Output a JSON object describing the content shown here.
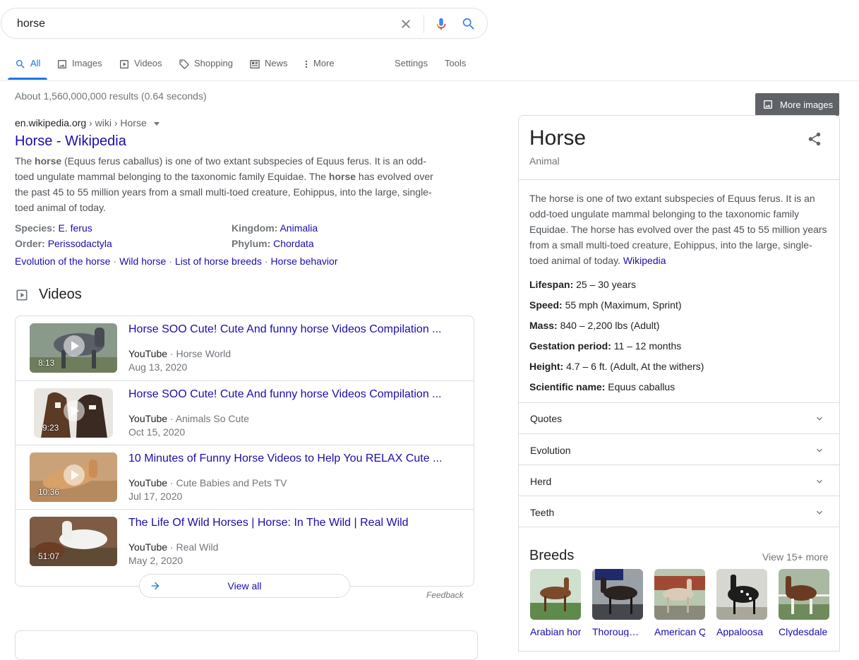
{
  "search": {
    "query": "horse"
  },
  "tabs": [
    {
      "label": "All",
      "icon": "search-icon"
    },
    {
      "label": "Images",
      "icon": "image-icon"
    },
    {
      "label": "Videos",
      "icon": "play-icon"
    },
    {
      "label": "Shopping",
      "icon": "tag-icon"
    },
    {
      "label": "News",
      "icon": "news-icon"
    },
    {
      "label": "More",
      "icon": "more-vert-icon"
    },
    {
      "label": "Settings"
    },
    {
      "label": "Tools"
    }
  ],
  "stats": "About 1,560,000,000 results (0.64 seconds)",
  "result": {
    "domain": "en.wikipedia.org",
    "path": " › wiki › Horse",
    "title": "Horse - Wikipedia",
    "snippet": [
      {
        "t": "The ",
        "b": false
      },
      {
        "t": "horse",
        "b": true
      },
      {
        "t": " (Equus ferus caballus) is one of two extant subspecies of Equus ferus. It is an odd-toed ungulate mammal belonging to the taxonomic family Equidae. The ",
        "b": false
      },
      {
        "t": "horse",
        "b": true
      },
      {
        "t": " has evolved over the past 45 to 55 million years from a small multi-toed creature, Eohippus, into the large, single-toed animal of today.",
        "b": false
      }
    ],
    "facts": [
      {
        "k": "Species:",
        "v": "E. ferus"
      },
      {
        "k": "Kingdom:",
        "v": "Animalia"
      },
      {
        "k": "Order:",
        "v": "Perissodactyla"
      },
      {
        "k": "Phylum:",
        "v": "Chordata"
      }
    ],
    "sitelinks": [
      "Evolution of the horse",
      "Wild horse",
      "List of horse breeds",
      "Horse behavior"
    ]
  },
  "videos": {
    "heading": "Videos",
    "items": [
      {
        "title": "Horse SOO Cute! Cute And funny horse Videos Compilation ...",
        "source": "YouTube",
        "channel": "Horse World",
        "date": "Aug 13, 2020",
        "duration": "8:13"
      },
      {
        "title": "Horse SOO Cute! Cute And funny horse Videos Compilation ...",
        "source": "YouTube",
        "channel": "Animals So Cute",
        "date": "Oct 15, 2020",
        "duration": "9:23"
      },
      {
        "title": "10 Minutes of Funny Horse Videos to Help You RELAX Cute ...",
        "source": "YouTube",
        "channel": "Cute Babies and Pets TV",
        "date": "Jul 17, 2020",
        "duration": "10:36"
      },
      {
        "title": "The Life Of Wild Horses | Horse: In The Wild | Real Wild",
        "source": "YouTube",
        "channel": "Real Wild",
        "date": "May 2, 2020",
        "duration": "51:07"
      }
    ],
    "separator": " · ",
    "view_all": "View all",
    "feedback": "Feedback"
  },
  "panel": {
    "more_images": "More images",
    "title": "Horse",
    "subtitle": "Animal",
    "description": "The horse is one of two extant subspecies of Equus ferus. It is an odd-toed ungulate mammal belonging to the taxonomic family Equidae. The horse has evolved over the past 45 to 55 million years from a small multi-toed creature, Eohippus, into the large, single-toed animal of today. ",
    "source_link": "Wikipedia",
    "facts": [
      {
        "k": "Lifespan:",
        "v": "25 – 30 years"
      },
      {
        "k": "Speed:",
        "v": "55 mph (Maximum, Sprint)"
      },
      {
        "k": "Mass:",
        "v": "840 – 2,200 lbs (Adult)"
      },
      {
        "k": "Gestation period:",
        "v": "11 – 12 months"
      },
      {
        "k": "Height:",
        "v": "4.7 – 6 ft. (Adult, At the withers)"
      },
      {
        "k": "Scientific name:",
        "v": "Equus caballus"
      }
    ],
    "accordions": [
      "Quotes",
      "Evolution",
      "Herd",
      "Teeth"
    ],
    "breeds_heading": "Breeds",
    "breeds_more": "View 15+ more",
    "breeds": [
      "Arabian horse",
      "Thoroughbred",
      "American Quarter Horse",
      "Appaloosa",
      "Clydesdale horse"
    ]
  },
  "colors": {
    "link": "#1a0dab",
    "accent": "#1a73e8",
    "muted": "#70757a"
  }
}
